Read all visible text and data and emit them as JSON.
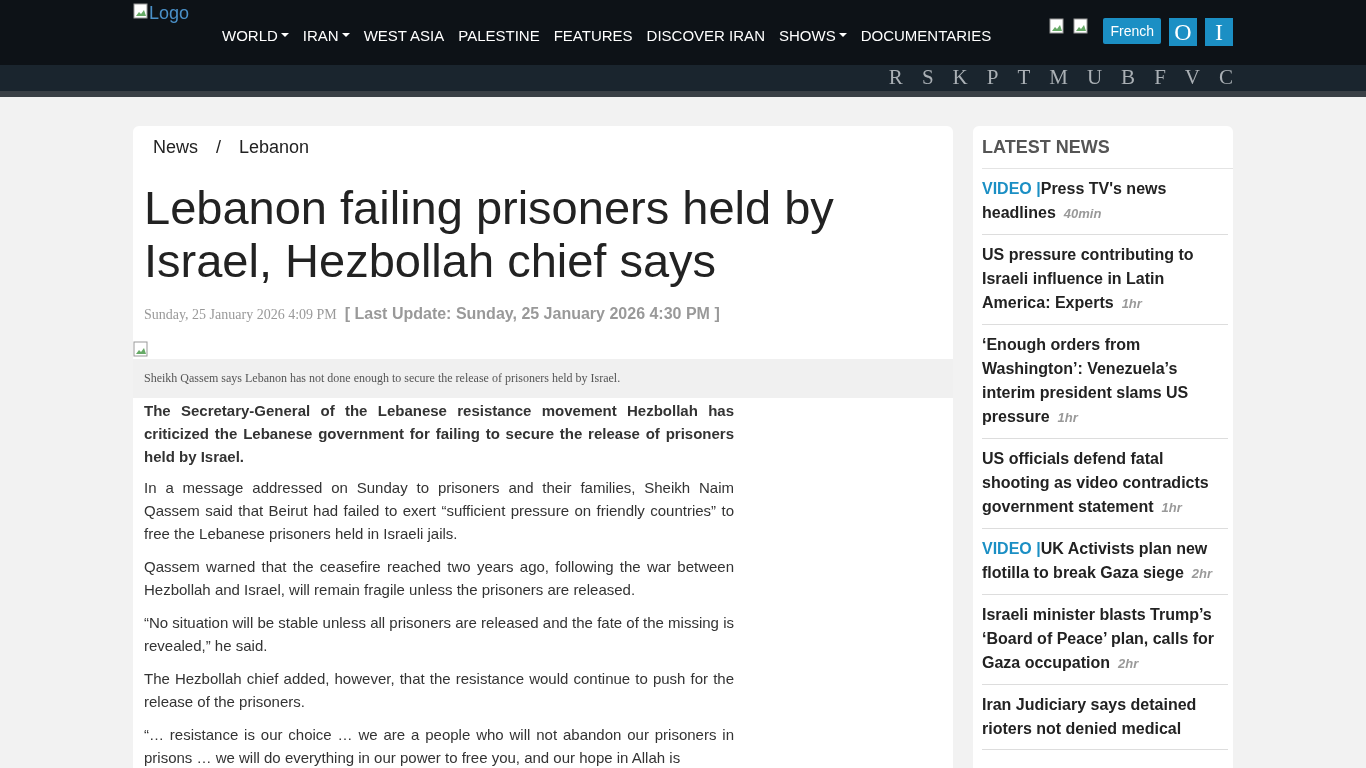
{
  "header": {
    "logo_alt": "Logo",
    "nav": [
      {
        "label": "WORLD",
        "dropdown": true
      },
      {
        "label": "IRAN",
        "dropdown": true
      },
      {
        "label": "WEST ASIA",
        "dropdown": false
      },
      {
        "label": "PALESTINE",
        "dropdown": false
      },
      {
        "label": "FEATURES",
        "dropdown": false
      },
      {
        "label": "DISCOVER IRAN",
        "dropdown": false
      },
      {
        "label": "SHOWS",
        "dropdown": true
      },
      {
        "label": "DOCUMENTARIES",
        "dropdown": false
      }
    ],
    "language_button": "French",
    "letter_buttons": [
      "O",
      "I"
    ],
    "letters": [
      "R",
      "S",
      "K",
      "P",
      "T",
      "M",
      "U",
      "B",
      "F",
      "V",
      "C"
    ]
  },
  "breadcrumb": [
    "News",
    "Lebanon"
  ],
  "breadcrumb_separator": "/",
  "article": {
    "title": "Lebanon failing prisoners held by Israel, Hezbollah chief says",
    "date": "Sunday, 25 January 2026 4:09 PM",
    "last_update": "[ Last Update: Sunday, 25 January 2026 4:30 PM ]",
    "caption": "Sheikh Qassem says Lebanon has not done enough to secure the release of prisoners held by Israel.",
    "lead": "The Secretary-General of the Lebanese resistance movement Hezbollah has criticized the Lebanese government for failing to secure the release of prisoners held by Israel.",
    "paragraphs": [
      "In a message addressed on Sunday to prisoners and their families, Sheikh Naim Qassem said that Beirut had failed to exert “sufficient pressure on friendly countries” to free the Lebanese prisoners held in Israeli jails.",
      "Qassem warned that the ceasefire reached two years ago, following the war between Hezbollah and Israel, will remain fragile unless the prisoners are released.",
      "“No situation will be stable unless all prisoners are released and the fate of the missing is revealed,” he said.",
      "The Hezbollah chief added, however, that the resistance would continue to push for the release of the prisoners.",
      "“… resistance is our choice … we are a people who will not abandon our prisoners in prisons … we will do everything in our power to free you, and our hope in Allah is"
    ]
  },
  "latest_news": {
    "title": "LATEST NEWS",
    "items": [
      {
        "tag": "VIDEO",
        "separator": "|",
        "headline": "Press TV's news headlines",
        "time": "40min"
      },
      {
        "headline": "US pressure contributing to Israeli influence in Latin America: Experts",
        "time": "1hr"
      },
      {
        "headline": "‘Enough orders from Washington’: Venezuela’s interim president slams US pressure",
        "time": "1hr"
      },
      {
        "headline": "US officials defend fatal shooting as video contradicts government statement",
        "time": "1hr"
      },
      {
        "tag": "VIDEO",
        "separator": "|",
        "headline": "UK Activists plan new flotilla to break Gaza siege",
        "time": "2hr"
      },
      {
        "headline": "Israeli minister blasts Trump’s ‘Board of Peace’ plan, calls for Gaza occupation",
        "time": "2hr"
      },
      {
        "headline": "Iran Judiciary says detained rioters not denied medical"
      }
    ]
  }
}
